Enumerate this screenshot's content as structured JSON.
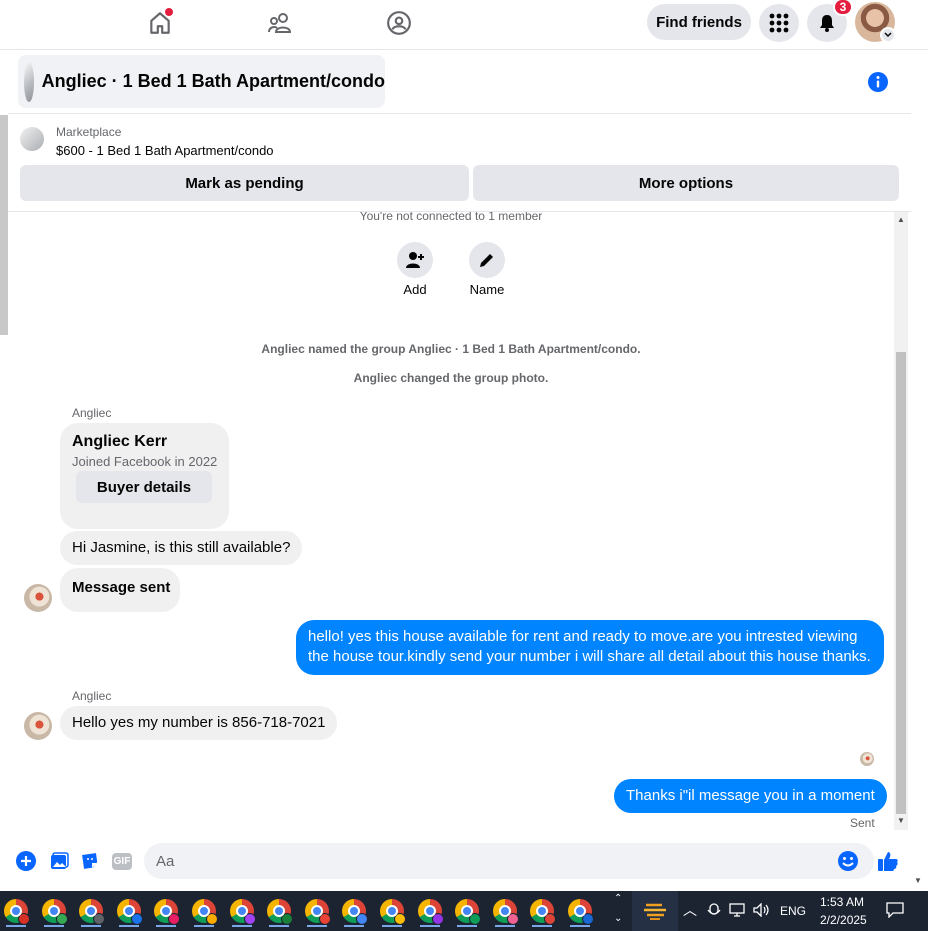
{
  "topnav": {
    "find_friends": "Find friends",
    "notifications_count": "3"
  },
  "chat": {
    "title": "Angliec · 1 Bed 1 Bath Apartment/condo"
  },
  "marketplace": {
    "label": "Marketplace",
    "listing": "$600 - 1 Bed 1 Bath Apartment/condo",
    "mark_pending": "Mark as pending",
    "more_options": "More options"
  },
  "messages": {
    "not_connected": "You're not connected to 1 member",
    "add_label": "Add",
    "name_label": "Name",
    "event_named": "Angliec named the group Angliec · 1 Bed 1 Bath Apartment/condo.",
    "event_photo": "Angliec changed the group photo.",
    "sender1": "Angliec",
    "card_name": "Angliec Kerr",
    "card_joined": "Joined Facebook in 2022",
    "buyer_details": "Buyer details",
    "msg1": "Hi Jasmine, is this still available?",
    "msg2": "Message sent",
    "out1_line1": "hello! yes this house available for rent and ready to move.are you intrested viewing",
    "out1_line2": "the house tour.kindly send your number i will share all detail about this house thanks.",
    "sender2": "Angliec",
    "msg3": "Hello yes my number is 856-718-7021",
    "out2": "Thanks i\"il message you in a moment",
    "status": "Sent"
  },
  "composer": {
    "placeholder": "Aa",
    "gif_label": "GIF"
  },
  "taskbar": {
    "lang": "ENG",
    "time": "1:53 AM",
    "date": "2/2/2025",
    "chrome_profile_colors": [
      "#d93025",
      "#34a853",
      "#5f6368",
      "#1a73e8",
      "#e91e63",
      "#f9ab00",
      "#a142f4",
      "#188038",
      "#ea4335",
      "#4285f4",
      "#fbbc04",
      "#9334e6",
      "#0f9d58",
      "#f06292",
      "#db4437",
      "#1967d2"
    ]
  },
  "colors": {
    "accent": "#0084ff",
    "badge": "#e41e3f",
    "info": "#0866ff"
  }
}
